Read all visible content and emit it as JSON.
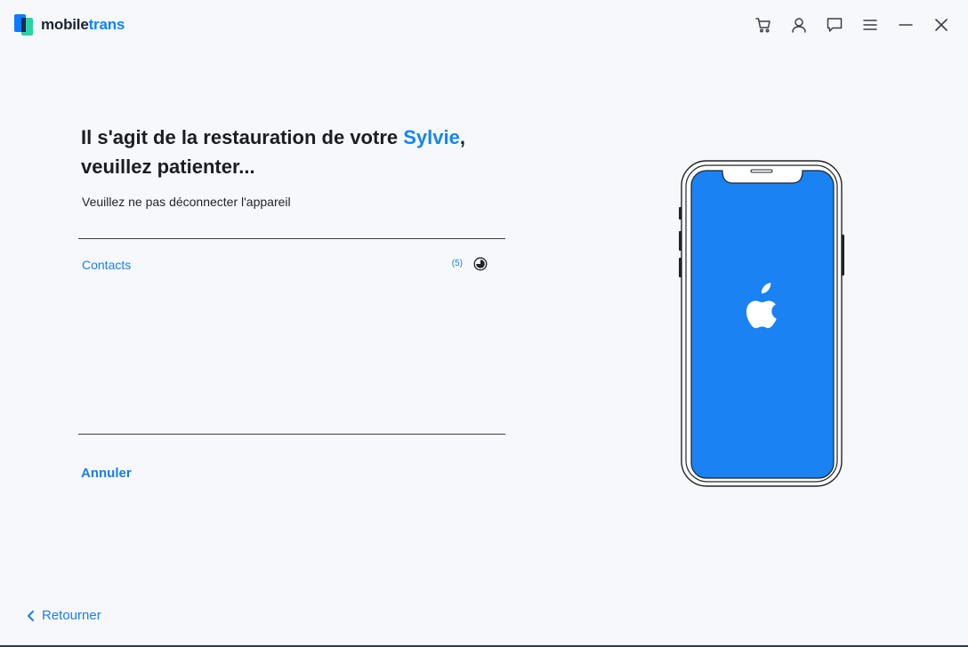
{
  "app": {
    "brand_prefix": "mobile",
    "brand_suffix": "trans",
    "accent_color": "#1486f2"
  },
  "window_controls": [
    {
      "name": "cart-icon"
    },
    {
      "name": "account-icon"
    },
    {
      "name": "feedback-icon"
    },
    {
      "name": "menu-icon"
    },
    {
      "name": "minimize-icon"
    },
    {
      "name": "close-icon"
    }
  ],
  "main": {
    "headline_prefix": "Il s'agit de la restauration de votre ",
    "device_name": "Sylvie",
    "headline_suffix": ",",
    "headline_line2": "veuillez patienter...",
    "subtitle": "Veuillez ne pas déconnecter l'appareil",
    "items": [
      {
        "label": "Contacts",
        "count": "(5)",
        "status_icon": "loading-spinner-icon"
      }
    ],
    "cancel_label": "Annuler"
  },
  "footer": {
    "back_label": "Retourner"
  },
  "device": {
    "screen_color": "#1a82f3",
    "logo": "apple-logo-icon"
  }
}
